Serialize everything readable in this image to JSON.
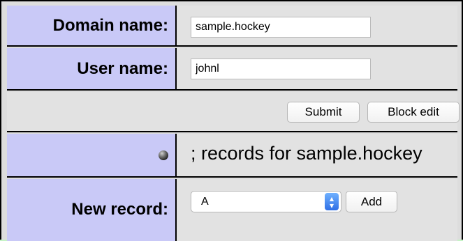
{
  "form": {
    "domain_label": "Domain name:",
    "domain_value": "sample.hockey",
    "user_label": "User name:",
    "user_value": "johnl",
    "submit_label": "Submit",
    "block_edit_label": "Block edit",
    "records_text": "; records for sample.hockey",
    "status_icon": "gray-bullet-icon",
    "new_record_label": "New record:",
    "record_type_selected": "A",
    "add_label": "Add"
  },
  "colors": {
    "page_background": "#c6f3c6",
    "label_background": "#c9c9f7",
    "value_background": "#e2e2e2",
    "select_arrow_blue": "#2f6fe6"
  }
}
